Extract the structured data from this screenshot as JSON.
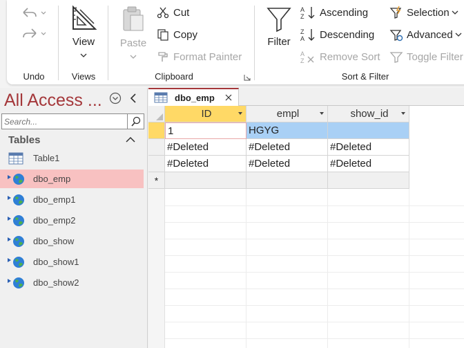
{
  "ribbon": {
    "undo_group": {
      "label": "Undo"
    },
    "views_group": {
      "label": "Views",
      "view_label": "View"
    },
    "clipboard_group": {
      "label": "Clipboard",
      "paste_label": "Paste",
      "cut_label": "Cut",
      "copy_label": "Copy",
      "format_painter_label": "Format Painter"
    },
    "sort_filter_group": {
      "label": "Sort & Filter",
      "filter_label": "Filter",
      "ascending_label": "Ascending",
      "descending_label": "Descending",
      "remove_sort_label": "Remove Sort",
      "selection_label": "Selection",
      "advanced_label": "Advanced",
      "toggle_filter_label": "Toggle Filter"
    }
  },
  "nav": {
    "title": "All Access ...",
    "search_placeholder": "Search...",
    "section_label": "Tables",
    "items": [
      {
        "label": "Table1",
        "icon": "local-table-icon"
      },
      {
        "label": "dbo_emp",
        "icon": "linked-table-icon"
      },
      {
        "label": "dbo_emp1",
        "icon": "linked-table-icon"
      },
      {
        "label": "dbo_emp2",
        "icon": "linked-table-icon"
      },
      {
        "label": "dbo_show",
        "icon": "linked-table-icon"
      },
      {
        "label": "dbo_show1",
        "icon": "linked-table-icon"
      },
      {
        "label": "dbo_show2",
        "icon": "linked-table-icon"
      }
    ]
  },
  "document": {
    "tab_label": "dbo_emp",
    "columns": [
      "ID",
      "empl",
      "show_id"
    ],
    "rows": [
      [
        "1",
        "HGYG",
        ""
      ],
      [
        "#Deleted",
        "#Deleted",
        "#Deleted"
      ],
      [
        "#Deleted",
        "#Deleted",
        "#Deleted"
      ]
    ],
    "new_row_marker": "*"
  },
  "colors": {
    "accent": "#a4373a",
    "selected_nav": "#f8c1c1",
    "active_header": "#ffd966",
    "selected_cell": "#a9d0f5"
  }
}
